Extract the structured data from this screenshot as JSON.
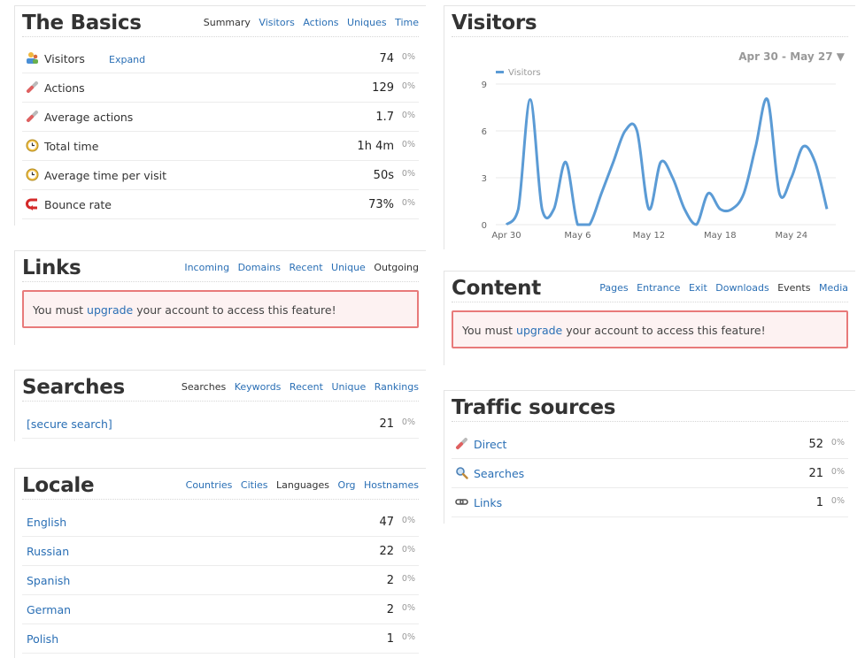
{
  "basics": {
    "title": "The Basics",
    "tabs": [
      "Summary",
      "Visitors",
      "Actions",
      "Uniques",
      "Time"
    ],
    "rows": [
      {
        "label": "Visitors",
        "value": "74",
        "pct": "0%",
        "expand": "Expand",
        "icon": "visitors-icon"
      },
      {
        "label": "Actions",
        "value": "129",
        "pct": "0%",
        "icon": "actions-icon"
      },
      {
        "label": "Average actions",
        "value": "1.7",
        "pct": "0%",
        "icon": "actions-icon"
      },
      {
        "label": "Total time",
        "value": "1h 4m",
        "pct": "0%",
        "icon": "clock-icon"
      },
      {
        "label": "Average time per visit",
        "value": "50s",
        "pct": "0%",
        "icon": "clock-icon"
      },
      {
        "label": "Bounce rate",
        "value": "73%",
        "pct": "0%",
        "icon": "bounce-icon"
      }
    ]
  },
  "links": {
    "title": "Links",
    "tabs": [
      "Incoming",
      "Domains",
      "Recent",
      "Unique",
      "Outgoing"
    ],
    "warning": {
      "pre": "You must ",
      "link": "upgrade",
      "post": " your account to access this feature!"
    }
  },
  "searches": {
    "title": "Searches",
    "tabs": [
      "Searches",
      "Keywords",
      "Recent",
      "Unique",
      "Rankings"
    ],
    "rows": [
      {
        "label": "[secure search]",
        "value": "21",
        "pct": "0%"
      }
    ]
  },
  "locale": {
    "title": "Locale",
    "tabs": [
      "Countries",
      "Cities",
      "Languages",
      "Org",
      "Hostnames"
    ],
    "rows": [
      {
        "label": "English",
        "value": "47",
        "pct": "0%"
      },
      {
        "label": "Russian",
        "value": "22",
        "pct": "0%"
      },
      {
        "label": "Spanish",
        "value": "2",
        "pct": "0%"
      },
      {
        "label": "German",
        "value": "2",
        "pct": "0%"
      },
      {
        "label": "Polish",
        "value": "1",
        "pct": "0%"
      }
    ]
  },
  "visitors": {
    "title": "Visitors",
    "date_range": "Apr 30 - May 27",
    "range_arrow": "▼"
  },
  "content": {
    "title": "Content",
    "tabs": [
      "Pages",
      "Entrance",
      "Exit",
      "Downloads",
      "Events",
      "Media"
    ],
    "warning": {
      "pre": "You must ",
      "link": "upgrade",
      "post": " your account to access this feature!"
    }
  },
  "traffic": {
    "title": "Traffic sources",
    "rows": [
      {
        "label": "Direct",
        "value": "52",
        "pct": "0%",
        "icon": "direct-icon"
      },
      {
        "label": "Searches",
        "value": "21",
        "pct": "0%",
        "icon": "magnifier-icon"
      },
      {
        "label": "Links",
        "value": "1",
        "pct": "0%",
        "icon": "chain-link-icon"
      }
    ]
  },
  "colors": {
    "link": "#2a6fb5",
    "line": "#5b9bd5",
    "warn_border": "#e87a7a",
    "warn_bg": "#fdf2f2"
  },
  "chart_data": {
    "type": "line",
    "series": [
      {
        "name": "Visitors",
        "values": [
          0,
          1,
          8,
          1,
          1,
          4,
          0,
          0,
          2,
          4,
          6,
          6,
          1,
          4,
          3,
          1,
          0,
          2,
          1,
          1,
          2,
          5,
          8,
          2,
          3,
          5,
          4,
          1
        ]
      }
    ],
    "x": [
      "Apr 30",
      "May 1",
      "May 2",
      "May 3",
      "May 4",
      "May 5",
      "May 6",
      "May 7",
      "May 8",
      "May 9",
      "May 10",
      "May 11",
      "May 12",
      "May 13",
      "May 14",
      "May 15",
      "May 16",
      "May 17",
      "May 18",
      "May 19",
      "May 20",
      "May 21",
      "May 22",
      "May 23",
      "May 24",
      "May 25",
      "May 26",
      "May 27"
    ],
    "x_tick_labels": [
      "Apr 30",
      "May 6",
      "May 12",
      "May 18",
      "May 24"
    ],
    "y_ticks": [
      0,
      3,
      6,
      9
    ],
    "ylim": [
      0,
      9
    ],
    "legend": "top-left",
    "grid": true
  }
}
